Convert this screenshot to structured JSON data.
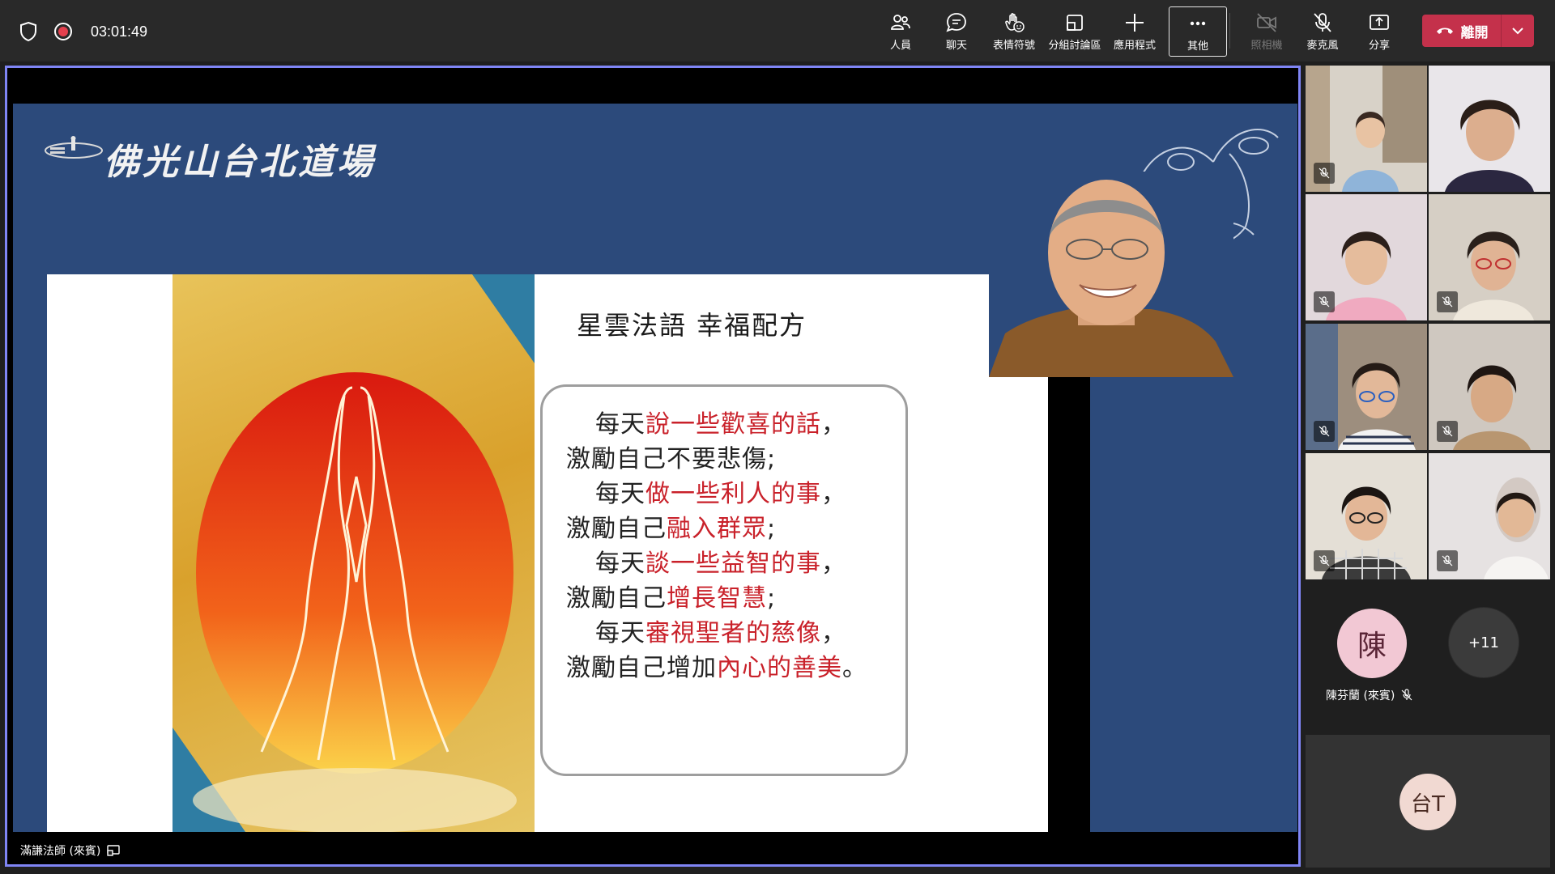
{
  "topbar": {
    "timer": "03:01:49",
    "tools": [
      {
        "label": "人員",
        "icon": "people-icon"
      },
      {
        "label": "聊天",
        "icon": "chat-icon"
      },
      {
        "label": "表情符號",
        "icon": "emoji-icon"
      },
      {
        "label": "分組討論區",
        "icon": "breakout-rooms-icon"
      },
      {
        "label": "應用程式",
        "icon": "plus-icon"
      },
      {
        "label": "其他",
        "icon": "more-icon"
      },
      {
        "label": "照相機",
        "icon": "camera-off-icon"
      },
      {
        "label": "麥克風",
        "icon": "mic-off-icon"
      },
      {
        "label": "分享",
        "icon": "share-icon"
      }
    ],
    "leave_label": "離開"
  },
  "slide": {
    "brand": "佛光山台北道場",
    "title": "星雲法語 幸福配方",
    "lines": [
      {
        "black": "每天",
        "red": "說一些歡喜的話",
        "end": "，"
      },
      {
        "black": "激勵自己不要悲傷;",
        "red": "",
        "end": ""
      },
      {
        "black": "每天",
        "red": "做一些利人的事",
        "end": "，"
      },
      {
        "black": "激勵自己",
        "red": "融入群眾",
        "end": ";"
      },
      {
        "black": "每天",
        "red": "談一些益智的事",
        "end": "，"
      },
      {
        "black": "激勵自己",
        "red": "增長智慧",
        "end": ";"
      },
      {
        "black": "每天",
        "red": "審視聖者的慈像",
        "end": "，"
      },
      {
        "black": "激勵自己增加",
        "red": "內心的善美",
        "end": "。"
      }
    ]
  },
  "presenter": {
    "name": "滿謙法師 (來賓)"
  },
  "gallery": {
    "chen": {
      "initial": "陳",
      "name": "陳芬蘭 (來賓)"
    },
    "overflow": "+11",
    "tai": {
      "initials": "台T"
    }
  },
  "colors": {
    "accent_border": "#7f85f5",
    "leave_red": "#c4314b",
    "slide_blue": "#2c4a7b",
    "text_red": "#c9212a"
  }
}
